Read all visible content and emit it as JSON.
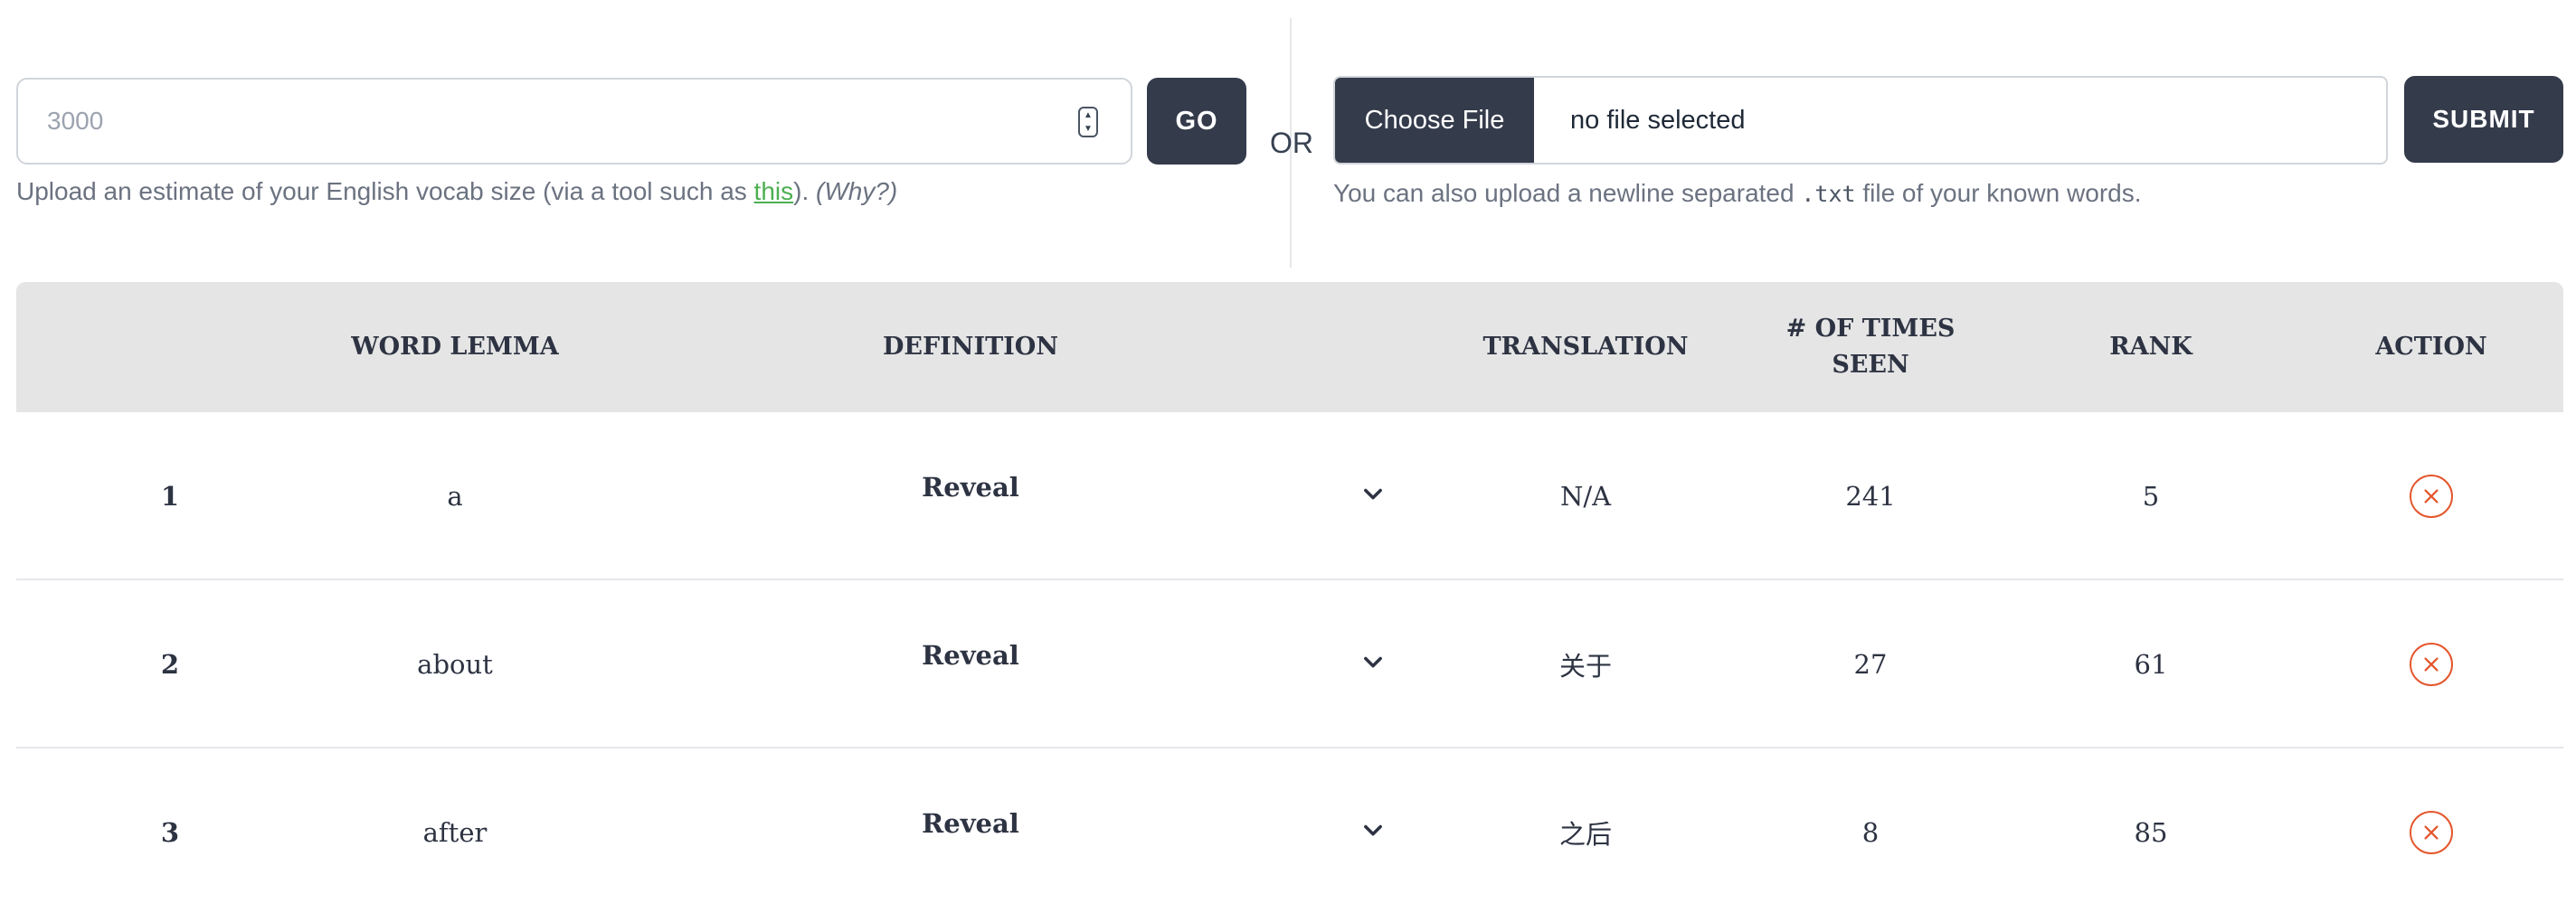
{
  "vocab": {
    "placeholder": "3000",
    "go_label": "GO",
    "help_prefix": "Upload an estimate of your English vocab size (via a tool such as ",
    "help_link": "this",
    "help_suffix": "). ",
    "help_why": "(Why?)"
  },
  "or_label": "OR",
  "file": {
    "choose_label": "Choose File",
    "file_name": "no file selected",
    "submit_label": "SUBMIT",
    "help_prefix": "You can also upload a newline separated ",
    "help_code": ".txt",
    "help_suffix": " file of your known words."
  },
  "table": {
    "headers": {
      "lemma": "WORD LEMMA",
      "definition": "DEFINITION",
      "translation": "TRANSLATION",
      "times_seen_line1": "# OF TIMES",
      "times_seen_line2": "SEEN",
      "rank": "RANK",
      "action": "ACTION"
    },
    "rows": [
      {
        "index": "1",
        "lemma": "a",
        "definition": "Reveal",
        "translation": "N/A",
        "times_seen": "241",
        "rank": "5"
      },
      {
        "index": "2",
        "lemma": "about",
        "definition": "Reveal",
        "translation": "关于",
        "times_seen": "27",
        "rank": "61"
      },
      {
        "index": "3",
        "lemma": "after",
        "definition": "Reveal",
        "translation": "之后",
        "times_seen": "8",
        "rank": "85"
      }
    ]
  },
  "icons": {
    "expand": "chevron-down-icon",
    "remove": "close-circle-icon",
    "remove_color": "#e4572e"
  },
  "colors": {
    "button_bg": "#343b4b",
    "header_bg": "#e5e5e5",
    "link": "#4caf50"
  }
}
